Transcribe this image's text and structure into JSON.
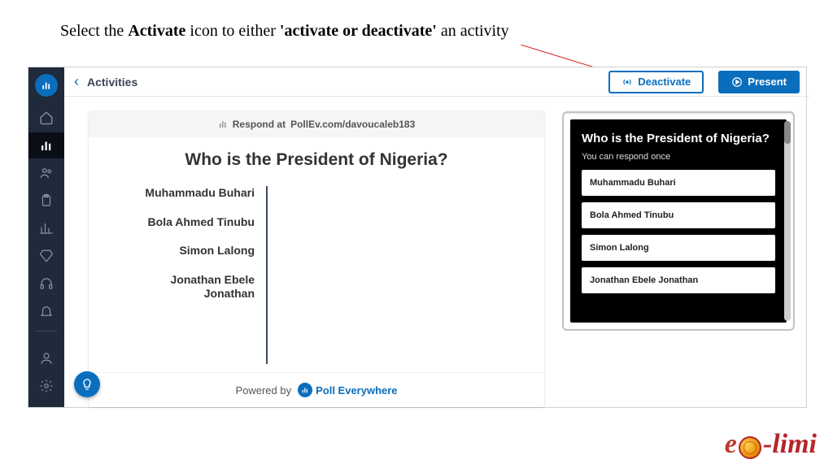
{
  "instruction": {
    "pre": "Select the ",
    "b1": "Activate",
    "mid": " icon to either ",
    "b2": "'activate or deactivate'",
    "post": " an activity"
  },
  "topbar": {
    "title": "Activities",
    "deactivate": "Deactivate",
    "present": "Present"
  },
  "poll": {
    "respond_prefix": "Respond at ",
    "respond_url": "PollEv.com/davoucaleb183",
    "question": "Who is the President of Nigeria?",
    "options": [
      "Muhammadu Buhari",
      "Bola Ahmed Tinubu",
      "Simon Lalong",
      "Jonathan Ebele Jonathan"
    ],
    "powered_by": "Powered by",
    "brand": "Poll Everywhere"
  },
  "preview": {
    "question": "Who is the President of Nigeria?",
    "subtext": "You can respond once",
    "options": [
      "Muhammadu Buhari",
      "Bola Ahmed Tinubu",
      "Simon Lalong",
      "Jonathan Ebele Jonathan"
    ]
  },
  "brandmark": {
    "text": "-limi"
  }
}
